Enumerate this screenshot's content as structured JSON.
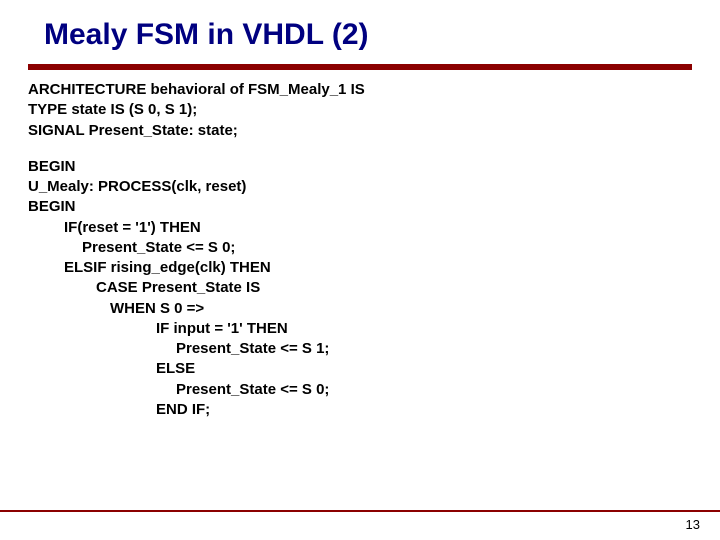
{
  "title": "Mealy FSM in VHDL (2)",
  "code": {
    "l1": "ARCHITECTURE behavioral of FSM_Mealy_1 IS",
    "l2": "TYPE state IS (S 0, S 1);",
    "l3": "SIGNAL Present_State: state;",
    "l4": "BEGIN",
    "l5": "U_Mealy: PROCESS(clk, reset)",
    "l6": "BEGIN",
    "l7": "IF(reset = '1') THEN",
    "l8": "Present_State <= S 0;",
    "l9": "ELSIF rising_edge(clk) THEN",
    "l10": "CASE Present_State IS",
    "l11": "WHEN S 0 =>",
    "l12": "IF input = '1' THEN",
    "l13": "Present_State <= S 1;",
    "l14": "ELSE",
    "l15": "Present_State <= S 0;",
    "l16": "END IF;"
  },
  "page_number": "13"
}
